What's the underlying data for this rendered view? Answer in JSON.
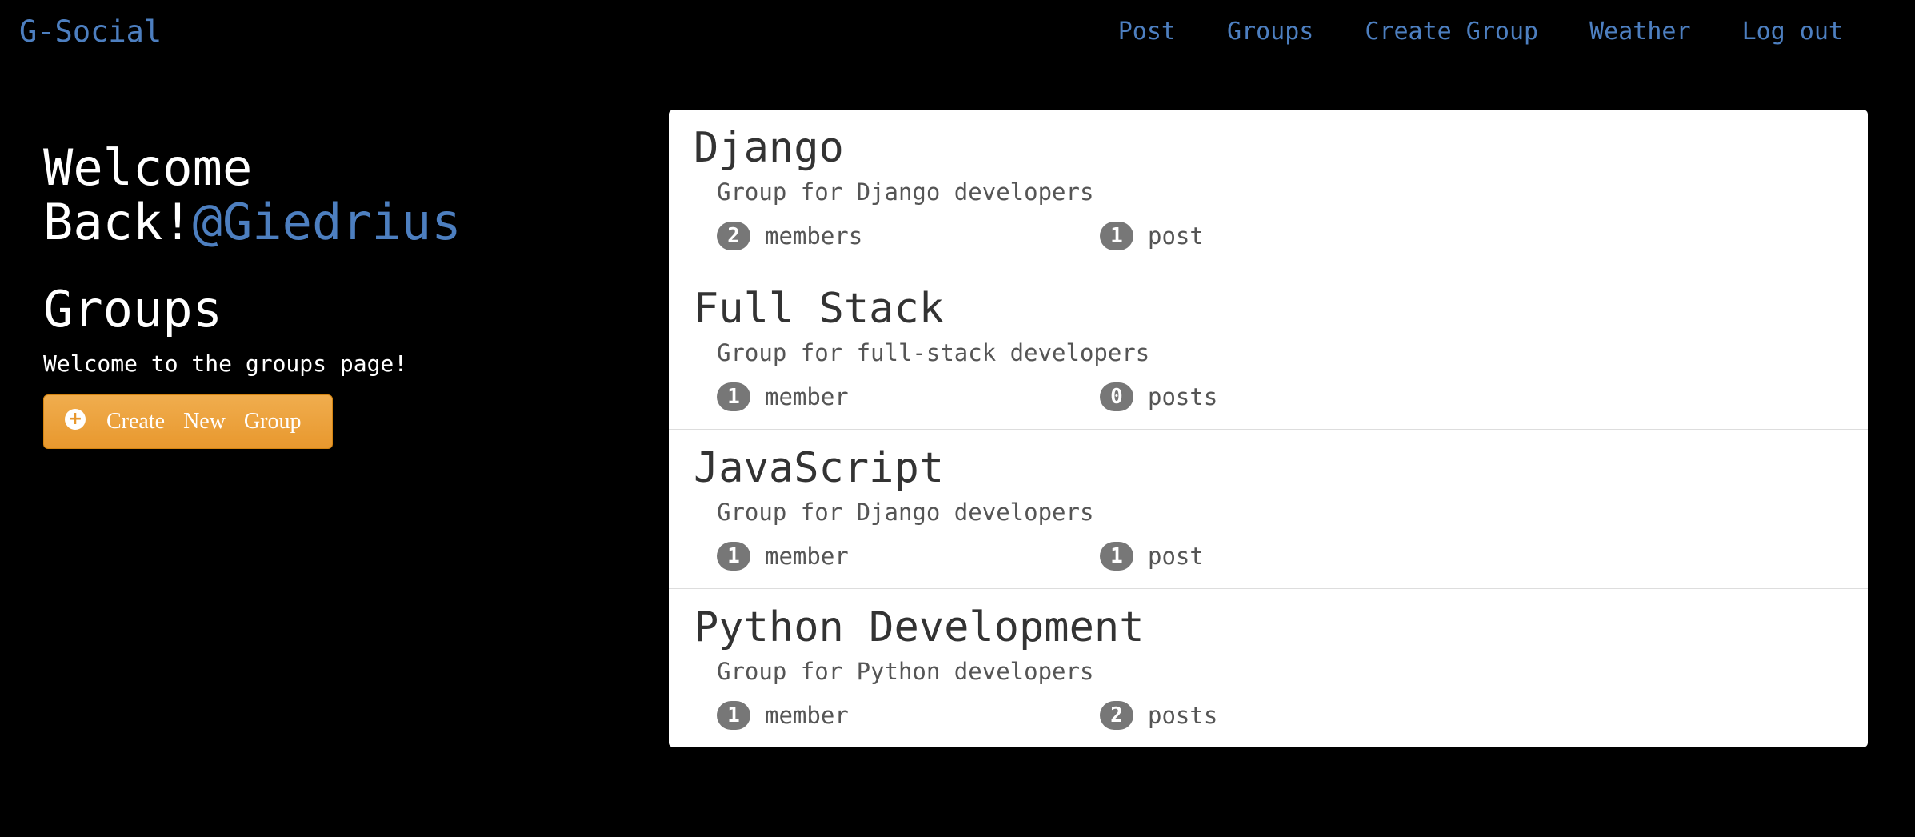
{
  "navbar": {
    "brand": "G-Social",
    "links": [
      "Post",
      "Groups",
      "Create Group",
      "Weather",
      "Log out"
    ]
  },
  "sidebar": {
    "welcome_prefix": "Welcome",
    "welcome_back": "Back!",
    "username": "@Giedrius",
    "groups_title": "Groups",
    "groups_subtitle": "Welcome to the groups page!",
    "create_button_label": "Create New Group",
    "create_button_icon": "plus-circle-icon"
  },
  "groups": [
    {
      "name": "Django",
      "description": "Group for Django developers",
      "members_count": "2",
      "members_label": "members",
      "posts_count": "1",
      "posts_label": "post"
    },
    {
      "name": "Full Stack",
      "description": "Group for full-stack developers",
      "members_count": "1",
      "members_label": "member",
      "posts_count": "0",
      "posts_label": "posts"
    },
    {
      "name": "JavaScript",
      "description": "Group for Django developers",
      "members_count": "1",
      "members_label": "member",
      "posts_count": "1",
      "posts_label": "post"
    },
    {
      "name": "Python Development",
      "description": "Group for Python developers",
      "members_count": "1",
      "members_label": "member",
      "posts_count": "2",
      "posts_label": "posts"
    }
  ],
  "colors": {
    "background": "#000000",
    "link": "#4d7fc0",
    "button": "#f0ad4e",
    "badge": "#777777"
  }
}
